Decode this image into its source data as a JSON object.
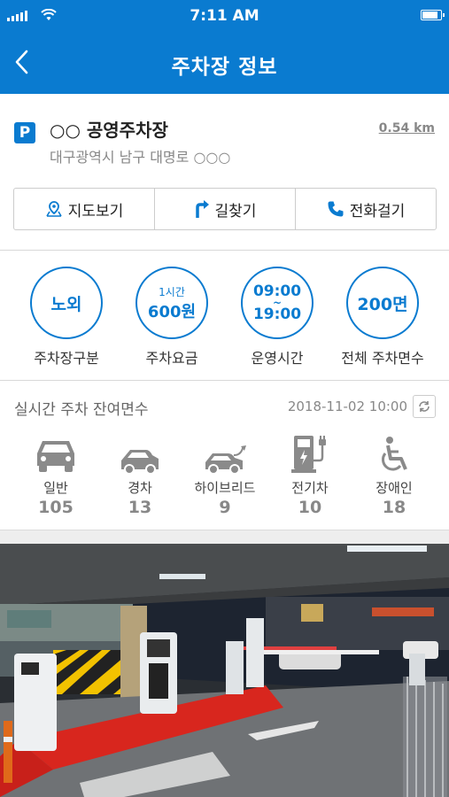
{
  "status_bar": {
    "time": "7:11 AM"
  },
  "header": {
    "title": "주차장 정보"
  },
  "lot": {
    "name": "○○ 공영주차장",
    "address": "대구광역시 남구 대명로 ○○○",
    "distance": "0.54 km",
    "p_label": "P"
  },
  "actions": [
    {
      "label": "지도보기",
      "icon": "map-pin-icon"
    },
    {
      "label": "길찾기",
      "icon": "directions-icon"
    },
    {
      "label": "전화걸기",
      "icon": "phone-icon"
    }
  ],
  "info": {
    "type": {
      "value": "노외",
      "label": "주차장구분"
    },
    "fee": {
      "unit": "1시간",
      "value": "600원",
      "label": "주차요금"
    },
    "hours": {
      "open": "09:00",
      "sep": "~",
      "close": "19:00",
      "label": "운영시간"
    },
    "total": {
      "value": "200면",
      "label": "전체 주차면수"
    }
  },
  "realtime": {
    "title": "실시간 주차 잔여면수",
    "timestamp": "2018-11-02 10:00",
    "vehicles": [
      {
        "label": "일반",
        "count": "105",
        "icon": "car-icon"
      },
      {
        "label": "경차",
        "count": "13",
        "icon": "compact-car-icon"
      },
      {
        "label": "하이브리드",
        "count": "9",
        "icon": "hybrid-car-icon"
      },
      {
        "label": "전기차",
        "count": "10",
        "icon": "ev-charger-icon"
      },
      {
        "label": "장애인",
        "count": "18",
        "icon": "wheelchair-icon"
      }
    ]
  },
  "colors": {
    "primary": "#0a7bd0",
    "icon_gray": "#8a8a8a"
  }
}
